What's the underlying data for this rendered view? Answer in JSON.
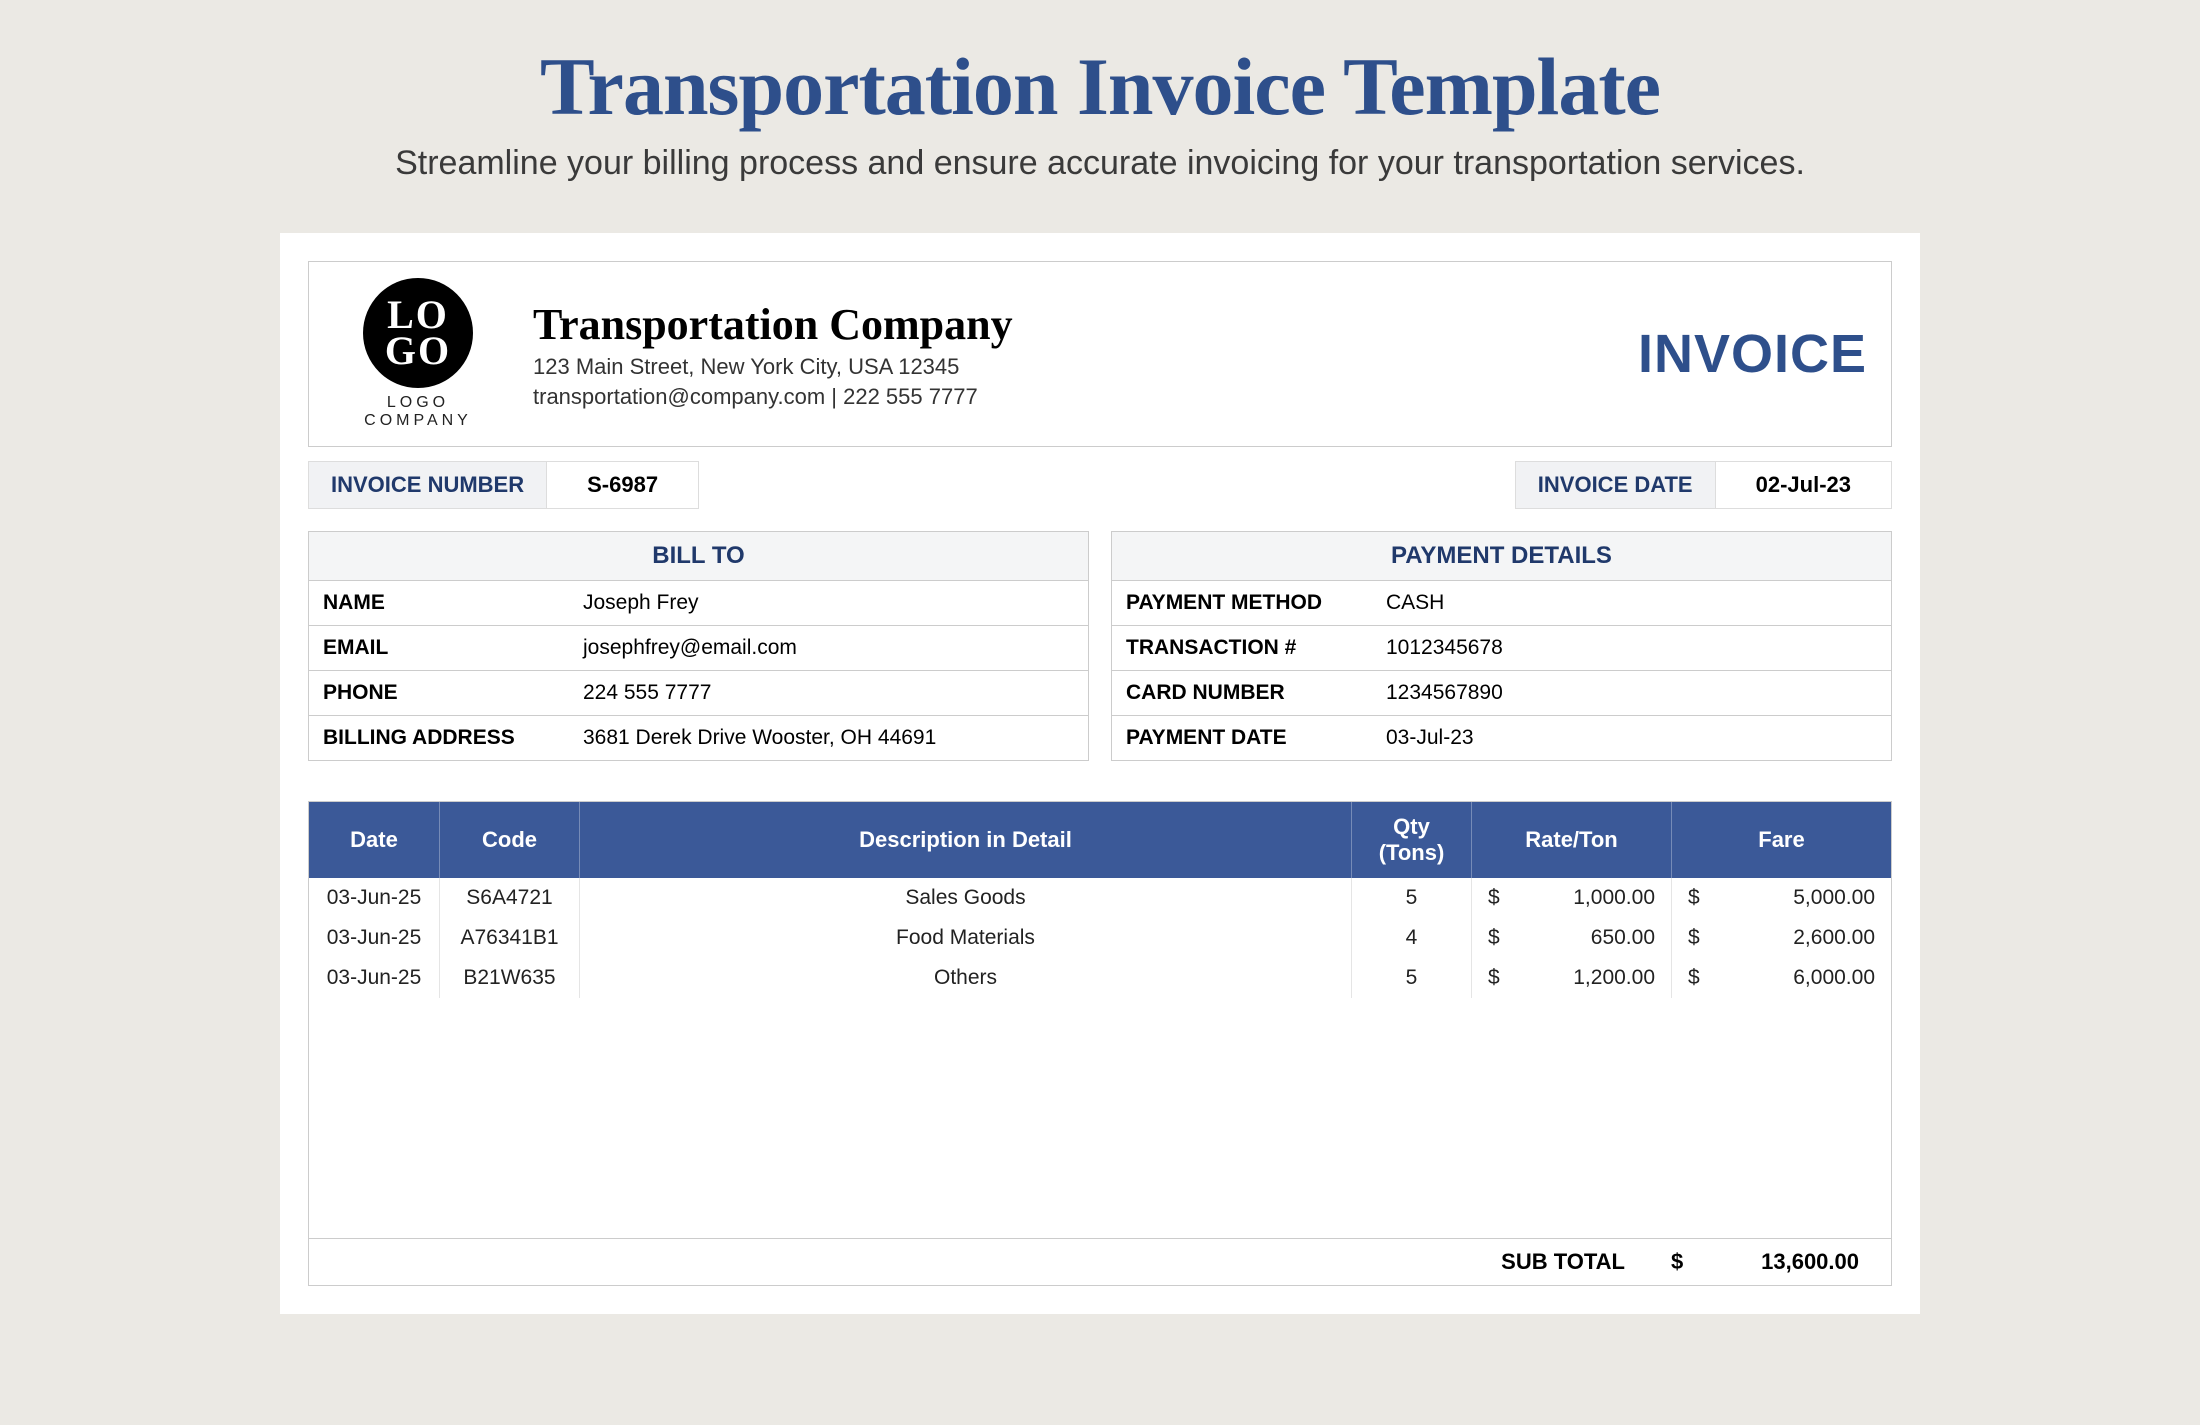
{
  "title": "Transportation Invoice Template",
  "subtitle": "Streamline your billing process and ensure accurate invoicing for your transportation services.",
  "logo": {
    "line1": "LO",
    "line2": "GO",
    "sub": "LOGO COMPANY"
  },
  "company": {
    "name": "Transportation Company",
    "address": "123 Main Street, New York City, USA 12345",
    "contact": "transportation@company.com | 222 555 7777"
  },
  "invoice_word": "INVOICE",
  "meta": {
    "num_label": "INVOICE NUMBER",
    "num": "S-6987",
    "date_label": "INVOICE DATE",
    "date": "02-Jul-23"
  },
  "bill": {
    "head": "BILL TO",
    "rows": [
      {
        "k": "NAME",
        "v": "Joseph Frey"
      },
      {
        "k": "EMAIL",
        "v": "josephfrey@email.com"
      },
      {
        "k": "PHONE",
        "v": "224 555 7777"
      },
      {
        "k": "BILLING ADDRESS",
        "v": "3681 Derek Drive Wooster, OH 44691"
      }
    ]
  },
  "pay": {
    "head": "PAYMENT DETAILS",
    "rows": [
      {
        "k": "PAYMENT METHOD",
        "v": "CASH"
      },
      {
        "k": "TRANSACTION #",
        "v": "1012345678"
      },
      {
        "k": "CARD NUMBER",
        "v": "1234567890"
      },
      {
        "k": "PAYMENT DATE",
        "v": "03-Jul-23"
      }
    ]
  },
  "table": {
    "head": {
      "date": "Date",
      "code": "Code",
      "desc": "Description in Detail",
      "qty1": "Qty",
      "qty2": "(Tons)",
      "rate": "Rate/Ton",
      "fare": "Fare"
    },
    "rows": [
      {
        "date": "03-Jun-25",
        "code": "S6A4721",
        "desc": "Sales Goods",
        "qty": "5",
        "rate": "1,000.00",
        "fare": "5,000.00"
      },
      {
        "date": "03-Jun-25",
        "code": "A76341B1",
        "desc": "Food Materials",
        "qty": "4",
        "rate": "650.00",
        "fare": "2,600.00"
      },
      {
        "date": "03-Jun-25",
        "code": "B21W635",
        "desc": "Others",
        "qty": "5",
        "rate": "1,200.00",
        "fare": "6,000.00"
      }
    ],
    "subtotal_label": "SUB TOTAL",
    "subtotal": "13,600.00",
    "currency": "$"
  }
}
